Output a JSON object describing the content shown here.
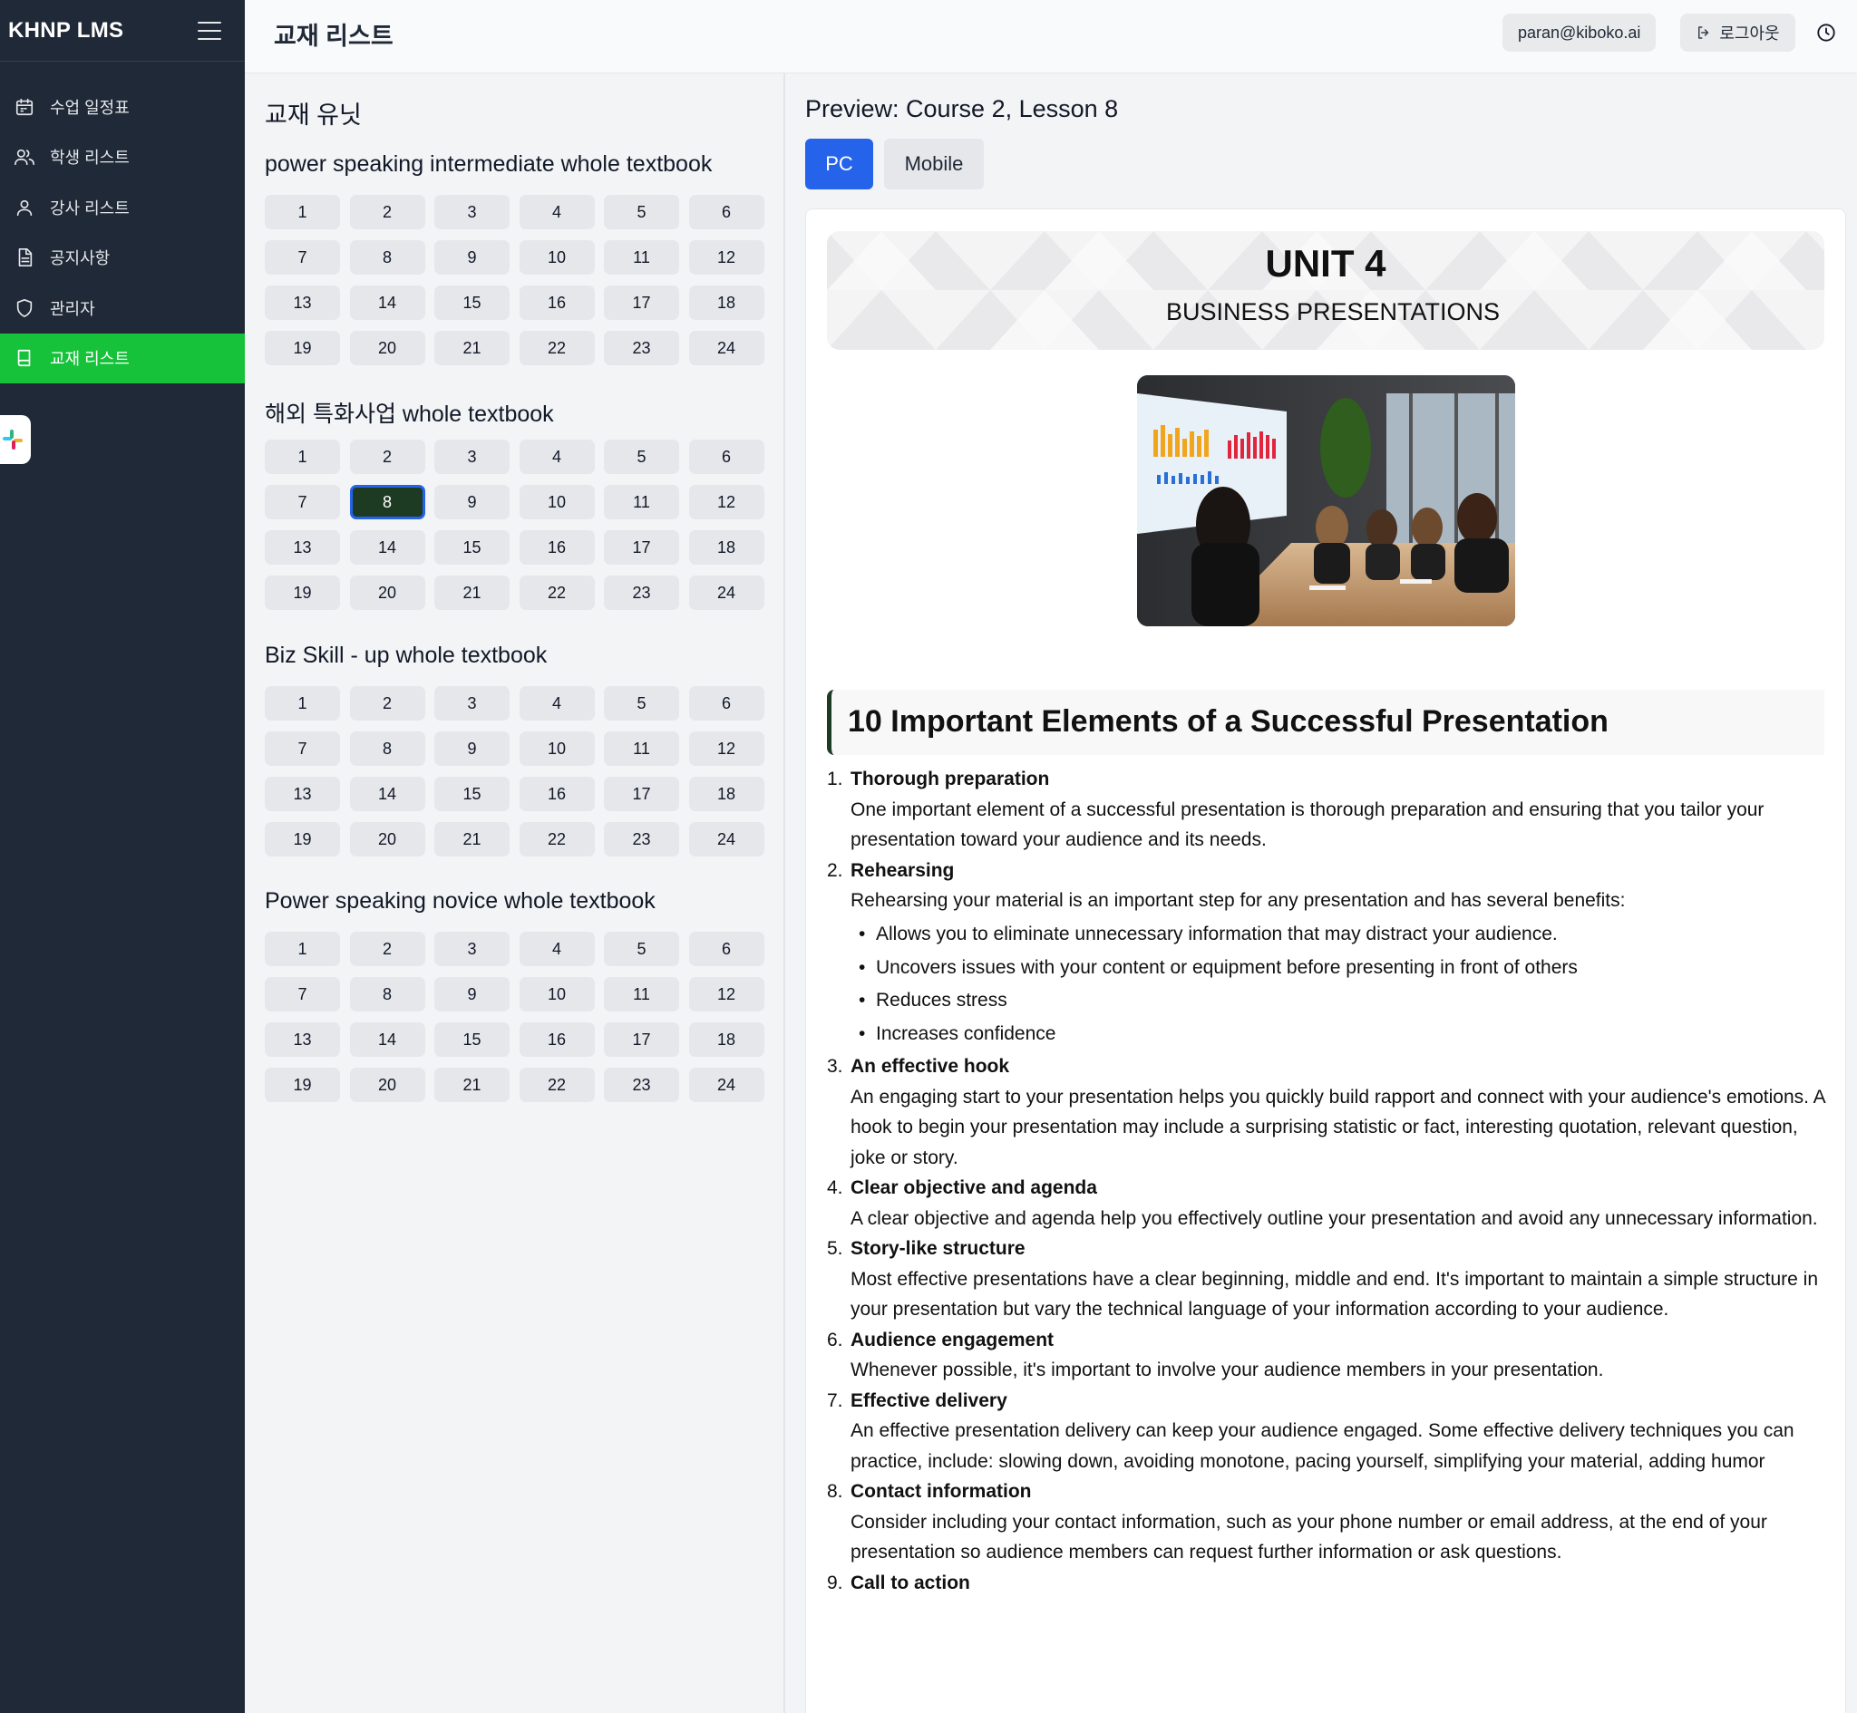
{
  "app": {
    "brand": "KHNP LMS",
    "page_title": "교재 리스트",
    "user_email": "paran@kiboko.ai",
    "logout_label": "로그아웃"
  },
  "sidebar": {
    "items": [
      {
        "label": "수업 일정표",
        "icon": "calendar-icon"
      },
      {
        "label": "학생 리스트",
        "icon": "users-icon"
      },
      {
        "label": "강사 리스트",
        "icon": "user-icon"
      },
      {
        "label": "공지사항",
        "icon": "document-icon"
      },
      {
        "label": "관리자",
        "icon": "shield-icon"
      },
      {
        "label": "교재 리스트",
        "icon": "book-icon",
        "active": true
      }
    ]
  },
  "units_panel": {
    "title": "교재 유닛",
    "books": [
      {
        "title": "power speaking intermediate whole textbook",
        "units": [
          "1",
          "2",
          "3",
          "4",
          "5",
          "6",
          "7",
          "8",
          "9",
          "10",
          "11",
          "12",
          "13",
          "14",
          "15",
          "16",
          "17",
          "18",
          "19",
          "20",
          "21",
          "22",
          "23",
          "24"
        ],
        "selected": null
      },
      {
        "title": "해외 특화사업 whole textbook",
        "units": [
          "1",
          "2",
          "3",
          "4",
          "5",
          "6",
          "7",
          "8",
          "9",
          "10",
          "11",
          "12",
          "13",
          "14",
          "15",
          "16",
          "17",
          "18",
          "19",
          "20",
          "21",
          "22",
          "23",
          "24"
        ],
        "selected": "8"
      },
      {
        "title": "Biz Skill - up whole textbook",
        "units": [
          "1",
          "2",
          "3",
          "4",
          "5",
          "6",
          "7",
          "8",
          "9",
          "10",
          "11",
          "12",
          "13",
          "14",
          "15",
          "16",
          "17",
          "18",
          "19",
          "20",
          "21",
          "22",
          "23",
          "24"
        ],
        "selected": null
      },
      {
        "title": "Power speaking novice whole textbook",
        "units": [
          "1",
          "2",
          "3",
          "4",
          "5",
          "6",
          "7",
          "8",
          "9",
          "10",
          "11",
          "12",
          "13",
          "14",
          "15",
          "16",
          "17",
          "18",
          "19",
          "20",
          "21",
          "22",
          "23",
          "24"
        ],
        "selected": null
      }
    ]
  },
  "preview": {
    "title": "Preview: Course 2, Lesson 8",
    "tabs": [
      {
        "label": "PC",
        "active": true
      },
      {
        "label": "Mobile",
        "active": false
      }
    ],
    "unit_number": "UNIT 4",
    "unit_subtitle": "BUSINESS PRESENTATIONS",
    "section_heading": "10 Important Elements of a Successful Presentation",
    "elements": [
      {
        "num": "1.",
        "title": "Thorough preparation",
        "desc": "One important element of a successful presentation is thorough preparation and ensuring that you tailor your presentation toward your audience and its needs."
      },
      {
        "num": "2.",
        "title": "Rehearsing",
        "desc": "Rehearsing your material is an important step for any presentation and has several benefits:",
        "bullets": [
          "Allows you to eliminate unnecessary information that may distract your audience.",
          "Uncovers issues with your content or equipment before presenting in front of others",
          "Reduces stress",
          "Increases confidence"
        ]
      },
      {
        "num": "3.",
        "title": "An effective hook",
        "desc": "An engaging start to your presentation helps you quickly build rapport and connect with your audience's emotions. A hook to begin your presentation may include a surprising statistic or fact, interesting quotation, relevant question, joke or story."
      },
      {
        "num": "4.",
        "title": "Clear objective and agenda",
        "desc": "A clear objective and agenda help you effectively outline your presentation and avoid any unnecessary information."
      },
      {
        "num": "5.",
        "title": "Story-like structure",
        "desc": "Most effective presentations have a clear beginning, middle and end. It's important to maintain a simple structure in your presentation but vary the technical language of your information according to your audience."
      },
      {
        "num": "6.",
        "title": "Audience engagement",
        "desc": "Whenever possible, it's important to involve your audience members in your presentation."
      },
      {
        "num": "7.",
        "title": "Effective delivery",
        "desc": "An effective presentation delivery can keep your audience engaged. Some effective delivery techniques you can practice, include: slowing down, avoiding monotone, pacing yourself, simplifying your material, adding humor"
      },
      {
        "num": "8.",
        "title": "Contact information",
        "desc": "Consider including your contact information, such as your phone number or email address, at the end of your presentation so audience members can request further information or ask questions."
      },
      {
        "num": "9.",
        "title": "Call to action",
        "desc": ""
      }
    ]
  },
  "colors": {
    "sidebar_bg": "#1f2937",
    "active_green": "#16c23a",
    "primary_blue": "#2563eb",
    "selected_unit": "#1d3b23"
  }
}
